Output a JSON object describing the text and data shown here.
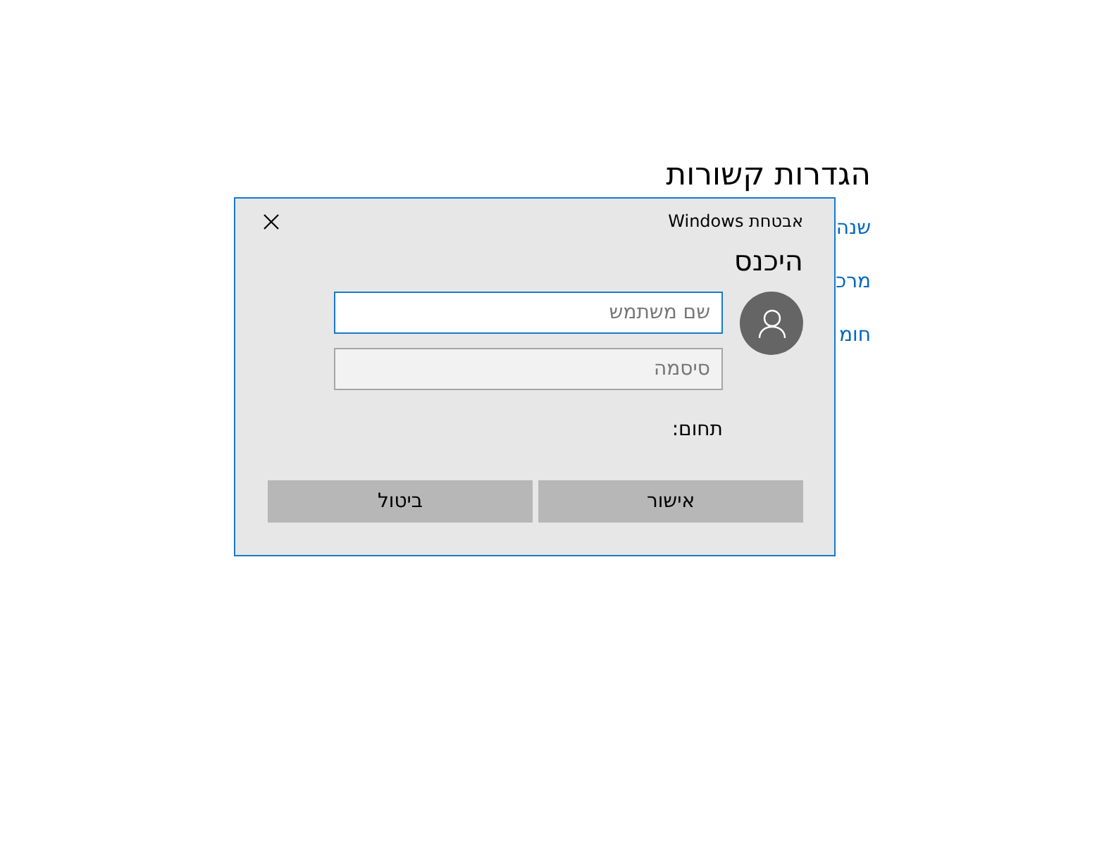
{
  "page": {
    "heading": "הגדרות קשורות",
    "links": [
      "שנה",
      "מרכ",
      "חומ"
    ]
  },
  "dialog": {
    "title": "אבטחת Windows",
    "heading": "היכנס",
    "fields": [
      {
        "placeholder": "שם משתמש",
        "focused": true
      },
      {
        "placeholder": "סיסמה",
        "focused": false
      }
    ],
    "domain_label": "תחום:",
    "buttons": [
      "אישור",
      "ביטול"
    ]
  }
}
